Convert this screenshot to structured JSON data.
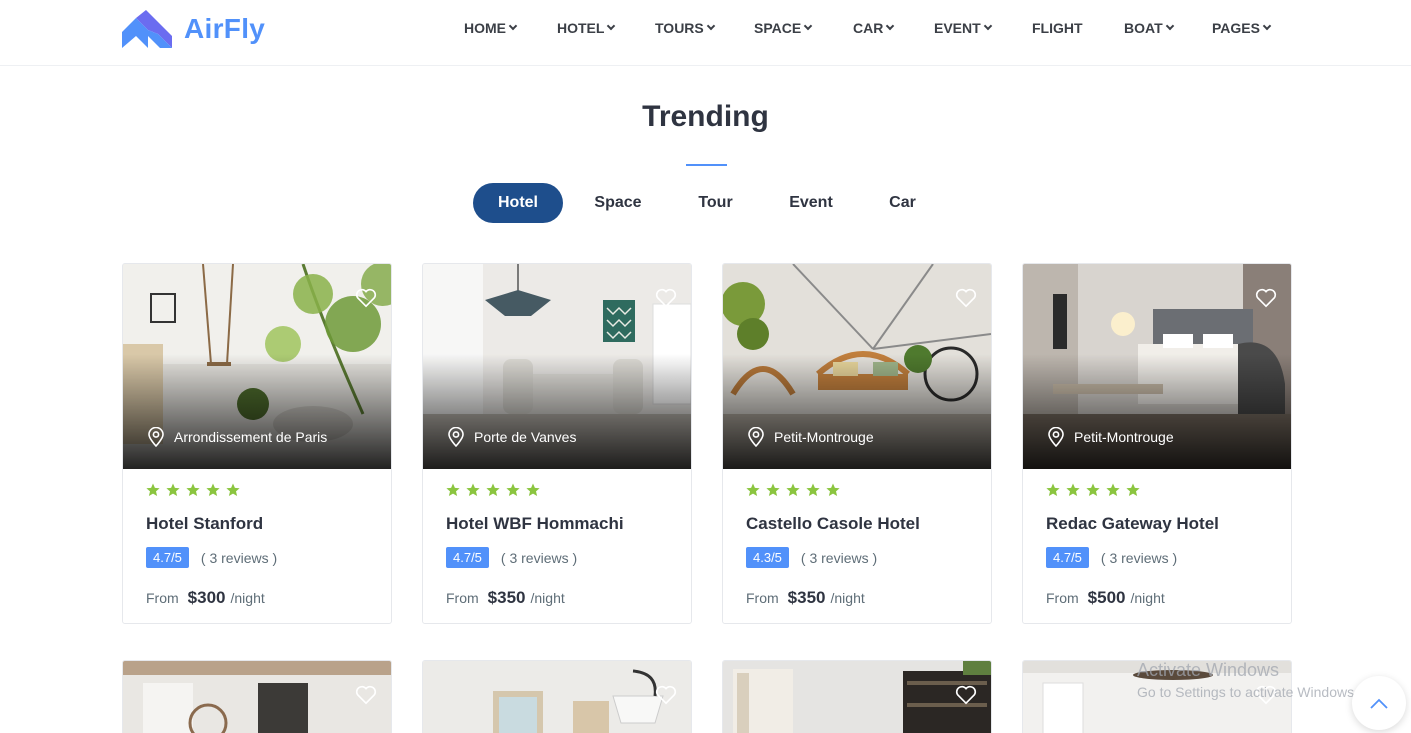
{
  "brand": {
    "name": "AirFly",
    "accent": "#5191fa",
    "logo_icon": "airfly-logo-icon"
  },
  "nav": [
    {
      "label": "HOME",
      "dropdown": true
    },
    {
      "label": "HOTEL",
      "dropdown": true
    },
    {
      "label": "TOURS",
      "dropdown": true
    },
    {
      "label": "SPACE",
      "dropdown": true
    },
    {
      "label": "CAR",
      "dropdown": true
    },
    {
      "label": "EVENT",
      "dropdown": true
    },
    {
      "label": "FLIGHT",
      "dropdown": false
    },
    {
      "label": "BOAT",
      "dropdown": true
    },
    {
      "label": "PAGES",
      "dropdown": true
    }
  ],
  "section": {
    "title": "Trending"
  },
  "tabs": [
    {
      "label": "Hotel",
      "active": true
    },
    {
      "label": "Space",
      "active": false
    },
    {
      "label": "Tour",
      "active": false
    },
    {
      "label": "Event",
      "active": false
    },
    {
      "label": "Car",
      "active": false
    }
  ],
  "cards": [
    {
      "location": "Arrondissement de Paris",
      "name": "Hotel Stanford",
      "stars": 5,
      "rating": "4.7/5",
      "reviews": "( 3 reviews )",
      "from_label": "From",
      "price": "$300",
      "unit": "/night"
    },
    {
      "location": "Porte de Vanves",
      "name": "Hotel WBF Hommachi",
      "stars": 5,
      "rating": "4.7/5",
      "reviews": "( 3 reviews )",
      "from_label": "From",
      "price": "$350",
      "unit": "/night"
    },
    {
      "location": "Petit-Montrouge",
      "name": "Castello Casole Hotel",
      "stars": 5,
      "rating": "4.3/5",
      "reviews": "( 3 reviews )",
      "from_label": "From",
      "price": "$350",
      "unit": "/night"
    },
    {
      "location": "Petit-Montrouge",
      "name": "Redac Gateway Hotel",
      "stars": 5,
      "rating": "4.7/5",
      "reviews": "( 3 reviews )",
      "from_label": "From",
      "price": "$500",
      "unit": "/night"
    }
  ],
  "watermark": {
    "line1": "Activate Windows",
    "line2": "Go to Settings to activate Windows."
  },
  "colors": {
    "star": "#8bc53f",
    "tab_active": "#1e4e8c",
    "badge": "#5191fa"
  }
}
